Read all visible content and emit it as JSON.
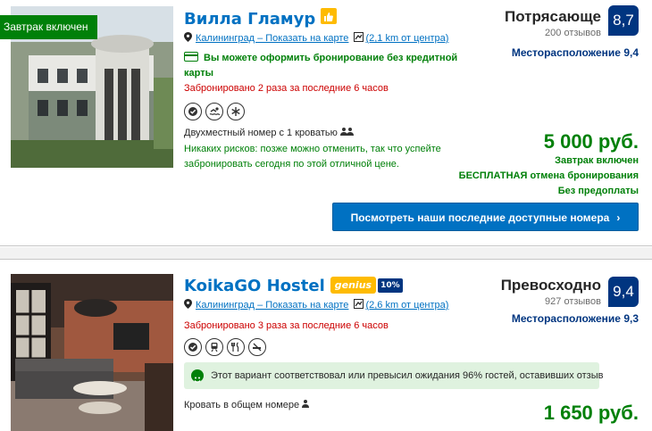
{
  "listings": [
    {
      "ribbon": "Завтрак включен",
      "name": "Вилла Гламур",
      "city_link": "Калининград – Показать на карте",
      "distance": "(2,1 km от центра)",
      "no_card": "Вы можете оформить бронирование без кредитной карты",
      "booked": "Забронировано 2 раза за последние 6 часов",
      "facility_icons": [
        "check-shield-icon",
        "pool-icon",
        "snowflake-icon"
      ],
      "room": "Двухместный номер с 1 кроватью",
      "no_risk": "Никаких рисков: позже можно отменить, так что успейте забронировать сегодня по этой отличной цене.",
      "rating_word": "Потрясающе",
      "reviews": "200 отзывов",
      "score": "8,7",
      "location_score": "Месторасположение 9,4",
      "price": "5 000 руб.",
      "price_notes": [
        "Завтрак включен",
        "БЕСПЛАТНАЯ отмена бронирования",
        "Без предоплаты"
      ],
      "cta": "Посмотреть наши последние доступные номера",
      "cta_chevron": "›"
    },
    {
      "name": "KoikaGO Hostel",
      "genius": "genius",
      "genius_pct": "10%",
      "city_link": "Калининград – Показать на карте",
      "distance": "(2,6 km от центра)",
      "booked": "Забронировано 3 раза за последние 6 часов",
      "facility_icons": [
        "check-shield-icon",
        "train-icon",
        "restaurant-icon",
        "no-smoking-icon"
      ],
      "match": "Этот вариант соответствовал или превысил ожидания 96% гостей, оставивших отзыв",
      "room": "Кровать в общем номере",
      "rating_word": "Превосходно",
      "reviews": "927 отзывов",
      "score": "9,4",
      "location_score": "Месторасположение 9,3",
      "price": "1 650 руб."
    }
  ],
  "colors": {
    "link_blue": "#0071c2",
    "score_navy": "#003580",
    "green": "#008009",
    "red": "#cc0000",
    "genius_yellow": "#febb02"
  }
}
